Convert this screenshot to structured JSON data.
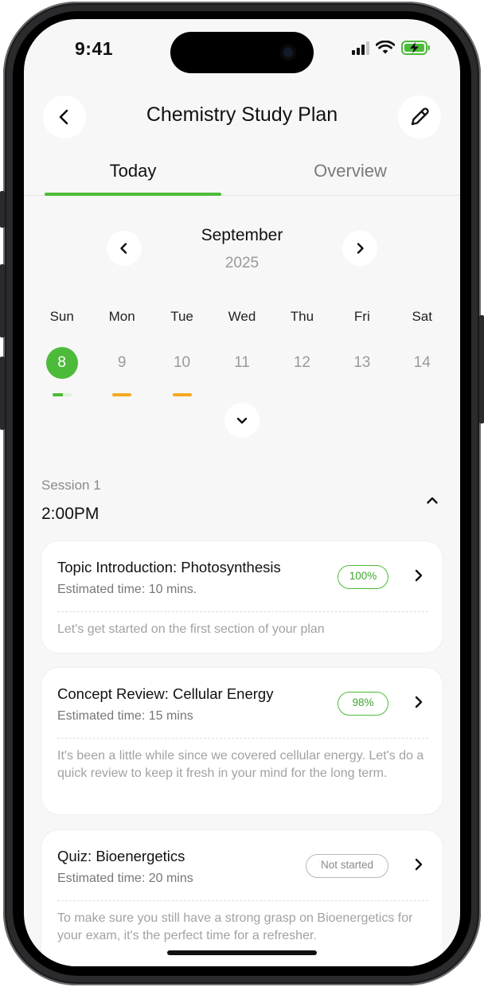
{
  "status_bar": {
    "time": "9:41"
  },
  "header": {
    "title": "Chemistry Study Plan"
  },
  "tabs": [
    {
      "label": "Today",
      "selected": true
    },
    {
      "label": "Overview",
      "selected": false
    }
  ],
  "calendar": {
    "month": "September",
    "year": "2025",
    "weekdays": [
      "Sun",
      "Mon",
      "Tue",
      "Wed",
      "Thu",
      "Fri",
      "Sat"
    ],
    "days": [
      {
        "num": "8",
        "selected": true,
        "indicator": "green"
      },
      {
        "num": "9",
        "selected": false,
        "indicator": "orange"
      },
      {
        "num": "10",
        "selected": false,
        "indicator": "orange"
      },
      {
        "num": "11",
        "selected": false,
        "indicator": "none"
      },
      {
        "num": "12",
        "selected": false,
        "indicator": "none"
      },
      {
        "num": "13",
        "selected": false,
        "indicator": "none"
      },
      {
        "num": "14",
        "selected": false,
        "indicator": "none"
      }
    ]
  },
  "session": {
    "label": "Session 1",
    "time": "2:00PM",
    "cards": [
      {
        "title": "Topic Introduction: Photosynthesis",
        "estimate": "Estimated time: 10 mins.",
        "status": "100%",
        "description": "Let's get started on the first section of your plan"
      },
      {
        "title": "Concept Review: Cellular Energy",
        "estimate": "Estimated time: 15 mins",
        "status": "98%",
        "description": "It's been a little while since we covered cellular energy. Let's do a quick review to keep it fresh in your mind for the long term."
      },
      {
        "title": "Quiz: Bioenergetics",
        "estimate": "Estimated time: 20 mins",
        "status": "Not started",
        "description": "To make sure you still have a strong grasp on Bioenergetics for your exam, it's the perfect time for a refresher."
      }
    ]
  },
  "colors": {
    "accent": "#4dbb3a",
    "warning": "#f4a823",
    "background": "#f7f7f7"
  },
  "icons": {
    "back": "chevron-left-icon",
    "edit": "pencil-icon",
    "prev_month": "chevron-left-icon",
    "next_month": "chevron-right-icon",
    "expand": "chevron-down-icon",
    "collapse": "chevron-up-icon",
    "open": "chevron-right-icon"
  }
}
